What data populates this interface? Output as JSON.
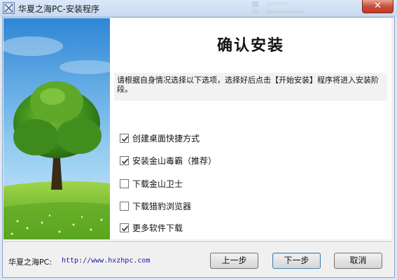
{
  "window": {
    "title": "华夏之海PC-安装程序",
    "close_glyph": "✕",
    "icon": "installer-icon"
  },
  "colors": {
    "title_bar": "#c7d9ef",
    "close_button": "#c8503a",
    "url_text": "#1a1aa6",
    "sky": "#4aa7e6",
    "grass": "#6fbf2c"
  },
  "main": {
    "heading": "确认安装",
    "instruction": "请根据自身情况选择以下选项，选择好后点击【开始安装】程序将进入安装阶段。",
    "options": [
      {
        "label": "创建桌面快捷方式",
        "checked": true
      },
      {
        "label": "安装金山毒霸（推荐）",
        "checked": true
      },
      {
        "label": "下载金山卫士",
        "checked": false
      },
      {
        "label": "下载猎豹浏览器",
        "checked": false
      },
      {
        "label": "更多软件下载",
        "checked": true
      }
    ]
  },
  "footer": {
    "brand": "华夏之海PC:",
    "url": "http://www.hxzhpc.com",
    "buttons": {
      "prev": "上一步",
      "next": "下一步",
      "cancel": "取消"
    }
  }
}
